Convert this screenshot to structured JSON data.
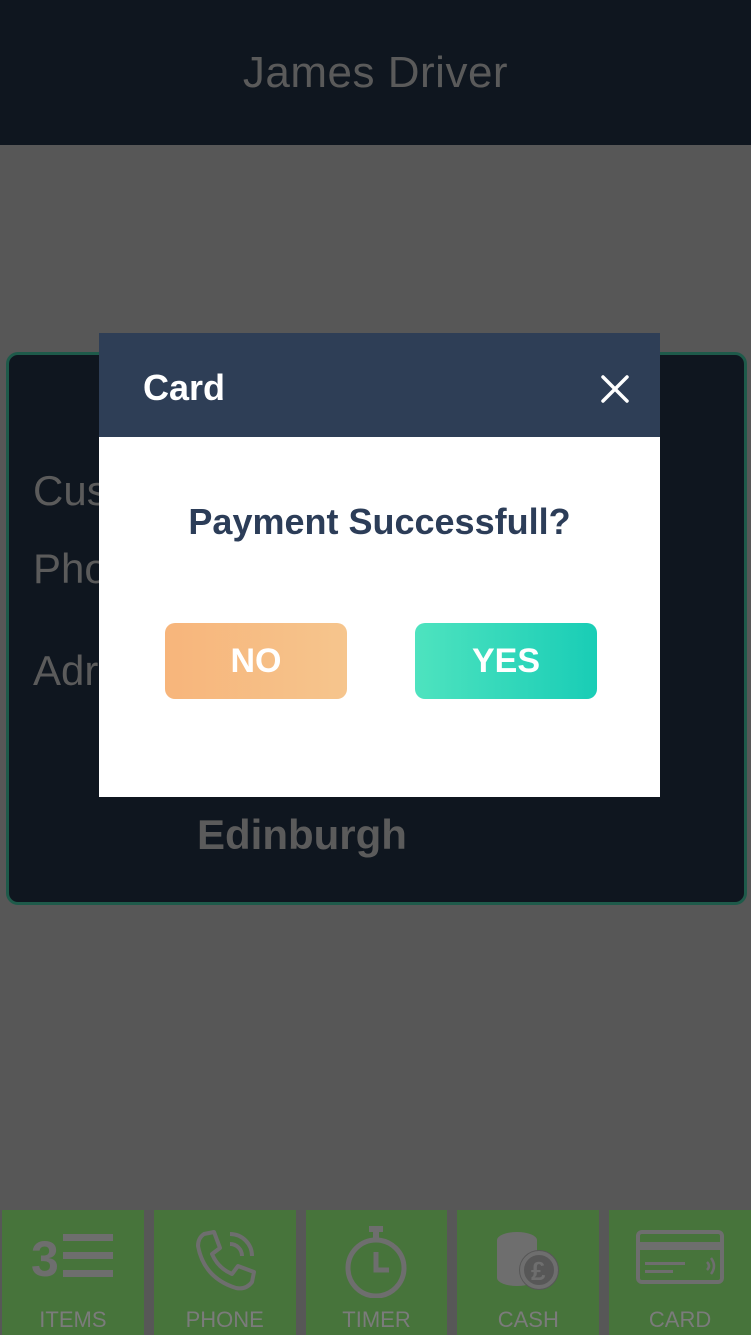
{
  "header": {
    "title": "James Driver"
  },
  "card": {
    "labels": [
      "Cus",
      "Pho",
      "Adr",
      ":"
    ],
    "city": "Edinburgh"
  },
  "modal": {
    "title": "Card",
    "question": "Payment Successfull?",
    "no_label": "NO",
    "yes_label": "YES"
  },
  "nav": {
    "items": [
      {
        "label": "ITEMS",
        "icon": "items-list-icon"
      },
      {
        "label": "PHONE",
        "icon": "phone-icon"
      },
      {
        "label": "TIMER",
        "icon": "timer-icon"
      },
      {
        "label": "CASH",
        "icon": "cash-coins-icon"
      },
      {
        "label": "CARD",
        "icon": "credit-card-icon"
      }
    ]
  },
  "colors": {
    "overlay": "#575757",
    "header_bg": "#0f161f",
    "modal_header": "#2e3e56",
    "no_button": "#f7b57b",
    "yes_button": "#19cdb6",
    "nav_bg": "#47743b"
  }
}
